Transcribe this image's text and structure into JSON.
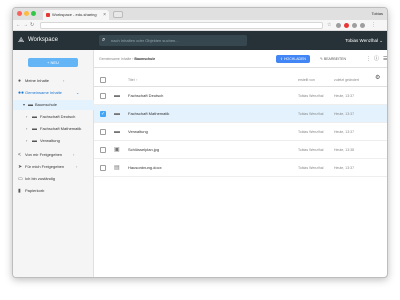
{
  "browser": {
    "tab_title": "Workspace - edu-sharing",
    "profile": "Tobias"
  },
  "app": {
    "brand": "Workspace",
    "search_placeholder": "nach Inhalten oder Objekten suchen...",
    "user_name": "Tobias Wenzlhal"
  },
  "sidebar": {
    "new_label": "NEU",
    "items": [
      {
        "label": "Meine Inhalte",
        "icon": "person-icon"
      },
      {
        "label": "Gemeinsame Inhalte",
        "icon": "group-icon"
      },
      {
        "label": "Baumschule",
        "icon": "folder-icon"
      },
      {
        "label": "Fachschaft Deutsch",
        "icon": "folder-icon"
      },
      {
        "label": "Fachschaft Mathematik",
        "icon": "folder-icon"
      },
      {
        "label": "Verwaltung",
        "icon": "folder-icon"
      },
      {
        "label": "Von mir Freigegeben",
        "icon": "share-icon"
      },
      {
        "label": "Für mich Freigegeben",
        "icon": "share-in-icon"
      },
      {
        "label": "Ich bin zuständig",
        "icon": "inbox-icon"
      },
      {
        "label": "Papierkorb",
        "icon": "trash-icon"
      }
    ]
  },
  "toolbar": {
    "breadcrumb_root": "Gemeinsame Inhalte",
    "breadcrumb_current": "Baumschule",
    "upload_label": "HOCHLADEN",
    "edit_label": "BEARBEITEN"
  },
  "table": {
    "columns": [
      "Titel",
      "erstellt von",
      "zuletzt geändert"
    ],
    "rows": [
      {
        "title": "Fachschaft Deutsch",
        "author": "Tobias Wenzlhal",
        "modified": "Heute, 13:37",
        "icon": "folder-icon",
        "selected": false
      },
      {
        "title": "Fachschaft Mathematik",
        "author": "Tobias Wenzlhal",
        "modified": "Heute, 13:37",
        "icon": "folder-icon",
        "selected": true
      },
      {
        "title": "Verwaltung",
        "author": "Tobias Wenzlhal",
        "modified": "Heute, 13:37",
        "icon": "folder-icon",
        "selected": false
      },
      {
        "title": "Schlüsselplan.jpg",
        "author": "Tobias Wenzlhal",
        "modified": "Heute, 13:38",
        "icon": "image-icon",
        "selected": false
      },
      {
        "title": "Hausordnung.docx",
        "author": "Tobias Wenzlhal",
        "modified": "Heute, 13:37",
        "icon": "document-icon",
        "selected": false
      }
    ]
  },
  "colors": {
    "topbar": "#263238",
    "accent": "#4285f4",
    "selected_row": "#e3f2fd"
  }
}
